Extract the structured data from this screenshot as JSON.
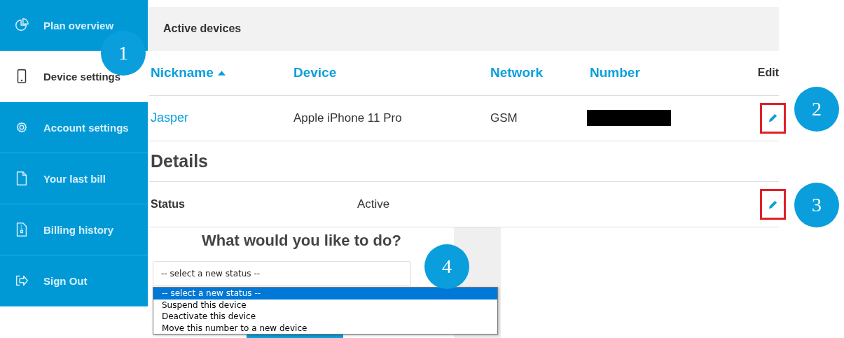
{
  "sidebar": {
    "items": [
      {
        "label": "Plan overview",
        "selected": false
      },
      {
        "label": "Device settings",
        "selected": true
      },
      {
        "label": "Account settings",
        "selected": false
      },
      {
        "label": "Your last bill",
        "selected": false
      },
      {
        "label": "Billing history",
        "selected": false
      },
      {
        "label": "Sign Out",
        "selected": false
      }
    ]
  },
  "section_title": "Active devices",
  "table": {
    "columns": [
      {
        "label": "Nickname",
        "kind": "link",
        "sorted": true
      },
      {
        "label": "Device",
        "kind": "link",
        "sorted": false
      },
      {
        "label": "Network",
        "kind": "link",
        "sorted": false
      },
      {
        "label": "Number",
        "kind": "link",
        "sorted": false
      },
      {
        "label": "Edit",
        "kind": "plain",
        "sorted": false
      }
    ],
    "rows": [
      {
        "nickname": "Jasper",
        "device": "Apple iPhone 11 Pro",
        "network": "GSM",
        "number_redacted": true,
        "edit_highlighted": true
      }
    ]
  },
  "details": {
    "title": "Details",
    "fields": [
      {
        "label": "Status",
        "value": "Active",
        "edit_highlighted": true
      }
    ]
  },
  "action_panel": {
    "title": "What would you like to do?",
    "select_value": "-- select a new status --",
    "options": [
      {
        "label": "-- select a new status --",
        "selected": true
      },
      {
        "label": "Suspend this device",
        "selected": false
      },
      {
        "label": "Deactivate this device",
        "selected": false
      },
      {
        "label": "Move this number to a new device",
        "selected": false
      }
    ]
  },
  "callouts": [
    {
      "label": "1"
    },
    {
      "label": "2"
    },
    {
      "label": "3"
    },
    {
      "label": "4"
    }
  ]
}
